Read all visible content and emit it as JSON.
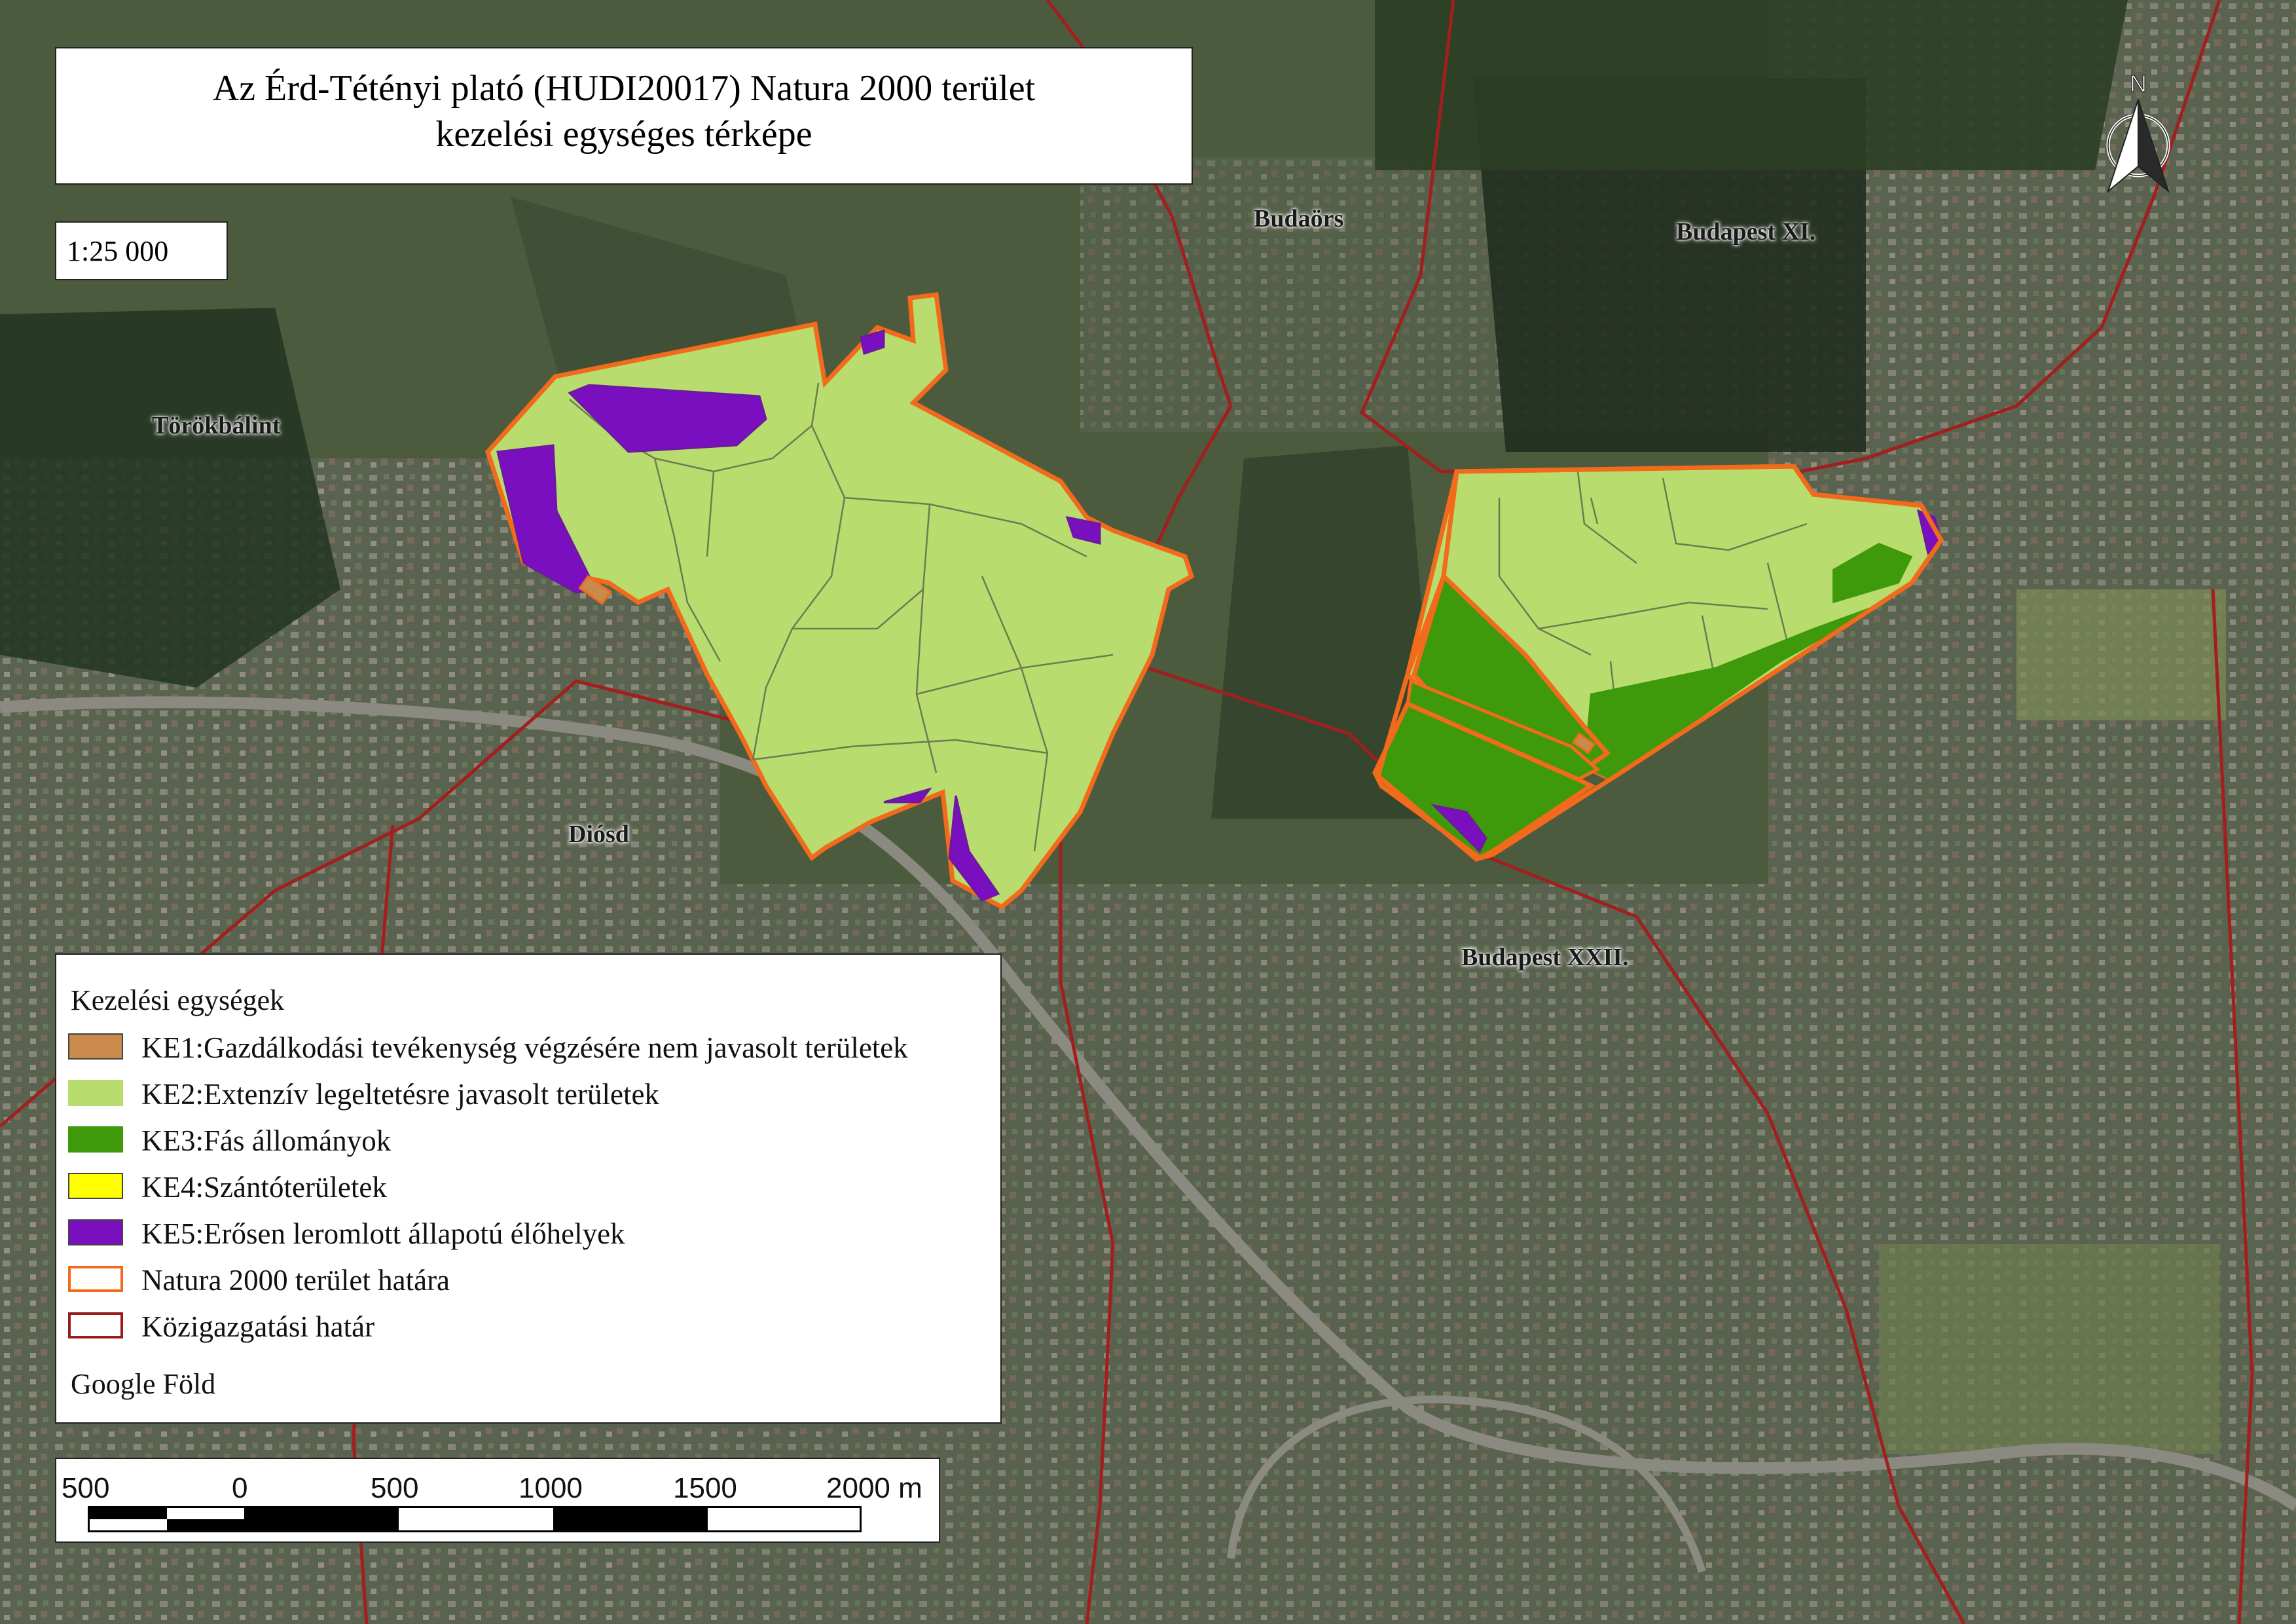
{
  "map": {
    "title_line1": "Az Érd-Tétényi plató (HUDI20017) Natura 2000 terület",
    "title_line2": "kezelési egységes térképe",
    "scale_ratio": "1:25 000",
    "north_label": "N",
    "places": [
      {
        "id": "budaors",
        "label": "Budaörs"
      },
      {
        "id": "budapest-xi",
        "label": "Budapest XI."
      },
      {
        "id": "torokbalint",
        "label": "Törökbálint"
      },
      {
        "id": "diosd",
        "label": "Diósd"
      },
      {
        "id": "budapest-xxii",
        "label": "Budapest XXII."
      }
    ]
  },
  "legend": {
    "title": "Kezelési egységek",
    "items": [
      {
        "id": "ke1",
        "label": "KE1:Gazdálkodási tevékenység végzésére nem javasolt területek",
        "fill": "#c98a4b",
        "stroke": "#444444"
      },
      {
        "id": "ke2",
        "label": "KE2:Extenzív legeltetésre javasolt területek",
        "fill": "#b8dc6e",
        "stroke": "#b8dc6e"
      },
      {
        "id": "ke3",
        "label": "KE3:Fás állományok",
        "fill": "#3f9a0b",
        "stroke": "#3f9a0b"
      },
      {
        "id": "ke4",
        "label": "KE4:Szántóterületek",
        "fill": "#ffff00",
        "stroke": "#444444"
      },
      {
        "id": "ke5",
        "label": "KE5:Erősen leromlott állapotú élőhelyek",
        "fill": "#7a0fbf",
        "stroke": "#444444"
      },
      {
        "id": "natura",
        "label": "Natura 2000 terület határa",
        "fill": "#ffffff",
        "stroke": "#f26a1b"
      },
      {
        "id": "admin",
        "label": "Közigazgatási határ",
        "fill": "#ffffff",
        "stroke": "#9b1b1b"
      }
    ],
    "source": "Google Föld"
  },
  "scalebar": {
    "labels": [
      "500",
      "0",
      "500",
      "1000",
      "1500",
      "2000 m"
    ]
  }
}
